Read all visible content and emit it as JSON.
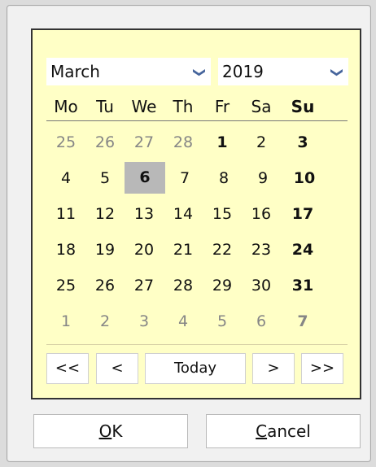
{
  "selectors": {
    "month": "March",
    "year": "2019",
    "arrow": "❯"
  },
  "weekdays": [
    "Mo",
    "Tu",
    "We",
    "Th",
    "Fr",
    "Sa",
    "Su"
  ],
  "weeks": [
    [
      "25",
      "26",
      "27",
      "28",
      "1",
      "2",
      "3"
    ],
    [
      "4",
      "5",
      "6",
      "7",
      "8",
      "9",
      "10"
    ],
    [
      "11",
      "12",
      "13",
      "14",
      "15",
      "16",
      "17"
    ],
    [
      "18",
      "19",
      "20",
      "21",
      "22",
      "23",
      "24"
    ],
    [
      "25",
      "26",
      "27",
      "28",
      "29",
      "30",
      "31"
    ],
    [
      "1",
      "2",
      "3",
      "4",
      "5",
      "6",
      "7"
    ]
  ],
  "selected_day": "6",
  "navigation": {
    "first": "<<",
    "previous": "<",
    "today": "Today",
    "next": ">",
    "last": ">>"
  },
  "buttons": {
    "ok_access": "O",
    "ok_rest": "K",
    "cancel_access": "C",
    "cancel_rest": "ancel"
  },
  "colors": {
    "calendar_background": "#ffffc6",
    "selected_background": "#b8b8b8",
    "dropdown_arrow": "#46659c",
    "muted_text": "#868686"
  }
}
